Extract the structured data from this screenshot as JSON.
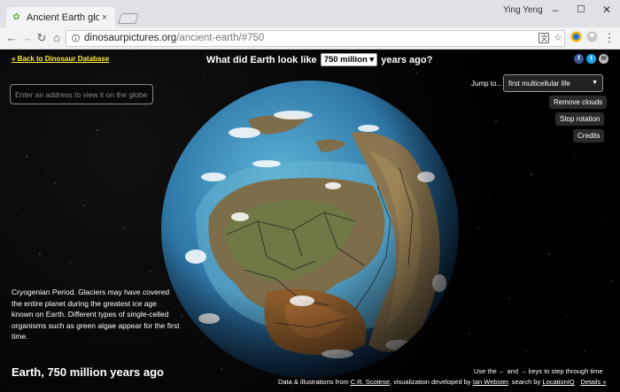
{
  "browser": {
    "tab_title": "Ancient Earth globe",
    "tab_close": "×",
    "user_name": "Ying Yeng",
    "window_controls": {
      "minimize": "–",
      "maximize": "☐",
      "close": "✕"
    },
    "url_host": "dinosaurpictures.org",
    "url_path": "/ancient-earth/#750",
    "nav": {
      "back": "←",
      "forward": "→",
      "reload": "↻",
      "home": "⌂"
    },
    "toolbar_icons": {
      "translate": "translate-icon",
      "bookmark": "☆",
      "extension": "extension-icon",
      "menu": "⋮"
    }
  },
  "header": {
    "back_link": "« Back to Dinosaur Database",
    "question_prefix": "What did Earth look like",
    "selected_years": "750 million",
    "question_suffix": "years ago?",
    "social": {
      "facebook": "f",
      "twitter": "t",
      "email": "✉"
    }
  },
  "search": {
    "placeholder": "Enter an address to view it on the globe"
  },
  "controls": {
    "jump_label": "Jump to...",
    "jump_selected": "first multicellular life",
    "remove_clouds": "Remove clouds",
    "stop_rotation": "Stop rotation",
    "credits": "Credits"
  },
  "period": {
    "description": "Cryogenian Period. Glaciers may have covered the entire planet during the greatest ice age known on Earth. Different types of single-celled organisms such as green algae appear for the first time.",
    "title": "Earth, 750 million years ago"
  },
  "footer": {
    "keys_hint": "Use the ← and → keys to step through time",
    "credits_prefix": "Data & illustrations from",
    "credits_scotese": "C.R. Scotese",
    "credits_mid": ", visualization developed by",
    "credits_ian": "Ian Webster",
    "credits_search": ", search by",
    "credits_locationiq": "LocationIQ",
    "credits_sep": "·",
    "details": "Details »"
  },
  "colors": {
    "accent_link": "#ffee33",
    "ocean_deep": "#1d4c7a",
    "ocean_shallow": "#4ea3c9",
    "land": "#7a6a4a",
    "facebook": "#3b5998",
    "twitter": "#1da1f2"
  }
}
